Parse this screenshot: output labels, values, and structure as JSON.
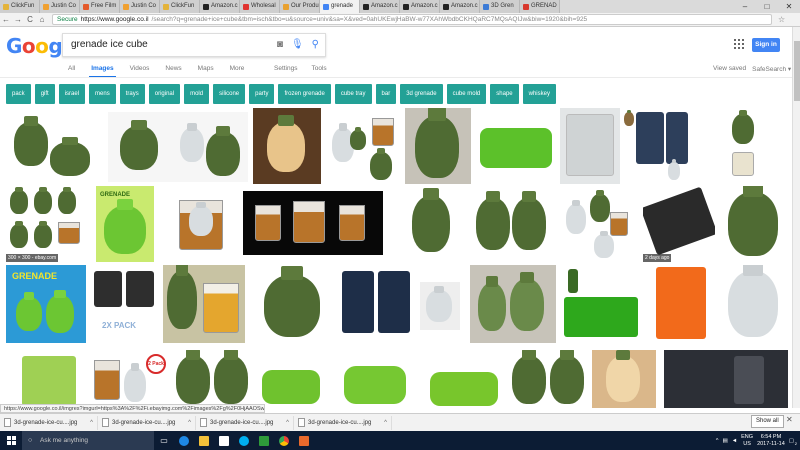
{
  "browser": {
    "tabs": [
      {
        "label": "ClickFun",
        "color": "#e4b33a"
      },
      {
        "label": "Justin Co",
        "color": "#f0a030"
      },
      {
        "label": "Free Film",
        "color": "#e45a2b"
      },
      {
        "label": "Justin Co",
        "color": "#f0a030"
      },
      {
        "label": "ClickFun",
        "color": "#e4b33a"
      },
      {
        "label": "Amazon.c",
        "color": "#222222"
      },
      {
        "label": "Wholesal",
        "color": "#e0332f"
      },
      {
        "label": "Our Produ",
        "color": "#e9a12f"
      },
      {
        "label": "grenade",
        "color": "#4285f4",
        "active": true
      },
      {
        "label": "Amazon.c",
        "color": "#222222"
      },
      {
        "label": "Amazon.c",
        "color": "#222222"
      },
      {
        "label": "Amazon.c",
        "color": "#222222"
      },
      {
        "label": "3D Gren",
        "color": "#3c7bd6"
      },
      {
        "label": "GRENAD",
        "color": "#d8382d"
      }
    ],
    "window_controls": [
      "–",
      "□",
      "✕"
    ],
    "nav": {
      "back": "←",
      "forward": "→",
      "reload": "C",
      "home": "⌂"
    },
    "address": {
      "secure_label": "Secure",
      "url_main": "https://www.google.co.il",
      "url_rest": "/search?q=grenade+ice+cube&tbm=isch&tbo=u&source=univ&sa=X&ved=0ahUKEwjHaBW-w77XAhWbdbCKHQaRC7MQsAQIJw&biw=1920&bih=925"
    }
  },
  "google": {
    "logo_letters": [
      {
        "char": "G",
        "color": "#4285f4"
      },
      {
        "char": "o",
        "color": "#ea4335"
      },
      {
        "char": "o",
        "color": "#fbbc05"
      },
      {
        "char": "g",
        "color": "#4285f4"
      },
      {
        "char": "l",
        "color": "#34a853"
      },
      {
        "char": "e",
        "color": "#ea4335"
      }
    ],
    "search_query": "grenade ice cube",
    "signin_label": "Sign in",
    "nav_links": [
      "All",
      "Images",
      "Videos",
      "News",
      "Maps",
      "More"
    ],
    "active_nav": "Images",
    "tool_links": [
      "Settings",
      "Tools"
    ],
    "right_links": [
      "View saved",
      "SafeSearch ▾"
    ],
    "chips": [
      "pack",
      "gift",
      "israel",
      "mens",
      "trays",
      "original",
      "mold",
      "silicone",
      "party",
      "frozen grenade",
      "cube tray",
      "bar",
      "3d grenade",
      "cube mold",
      "shape",
      "whiskey"
    ],
    "image_captions": {
      "size_badge": "300 × 300 - ebay.com",
      "age_badge": "2 days ago",
      "grenade_label": "GRENADE",
      "pack_label": "2X PACK",
      "two_pack": "2 Pack"
    }
  },
  "status_url": "https://www.google.co.il/imgres?imgurl=https%3A%2F%2Fi.ebayimg.com%2Fimages%2Fg%2F0HjAAOSwCx6V6sQ...",
  "downloads": {
    "items": [
      "3d-grenade-ice-cu....jpg",
      "3d-grenade-ice-cu....jpg",
      "3d-grenade-ice-cu....jpg",
      "3d-grenade-ice-cu....jpg"
    ],
    "show_all": "Show all",
    "close": "✕"
  },
  "taskbar": {
    "search_placeholder": "Ask me anything",
    "lang_top": "ENG",
    "lang_bottom": "US",
    "time": "6:54 PM",
    "date": "2017-11-14",
    "notification_count": "2"
  }
}
